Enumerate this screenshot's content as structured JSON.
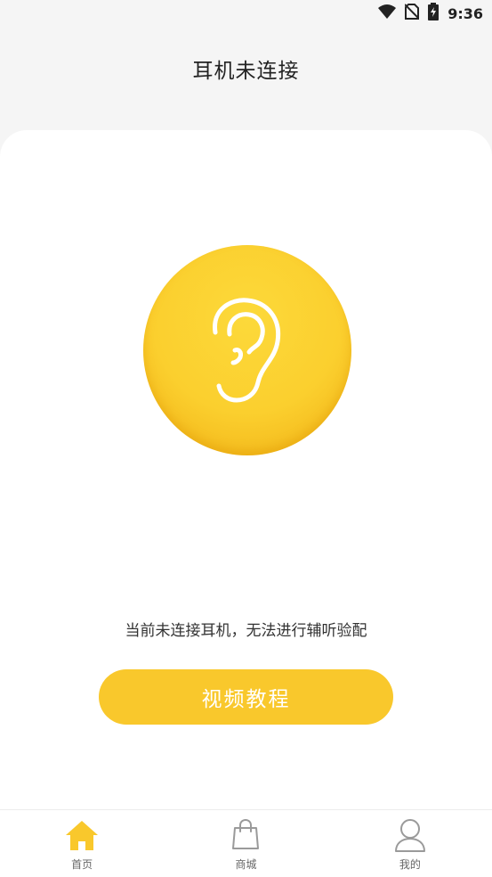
{
  "status_bar": {
    "time": "9:36",
    "icons": [
      "wifi-icon",
      "no-sim-icon",
      "battery-charging-icon"
    ]
  },
  "header": {
    "title": "耳机未连接"
  },
  "main": {
    "center_icon": "ear-icon",
    "accent_color": "#f9c82c",
    "notice": "当前未连接耳机，无法进行辅听验配",
    "video_button_label": "视频教程"
  },
  "tab_bar": {
    "tabs": [
      {
        "label": "首页",
        "icon": "home-icon",
        "active": true
      },
      {
        "label": "商城",
        "icon": "shopping-bag-icon",
        "active": false
      },
      {
        "label": "我的",
        "icon": "user-icon",
        "active": false
      }
    ]
  }
}
